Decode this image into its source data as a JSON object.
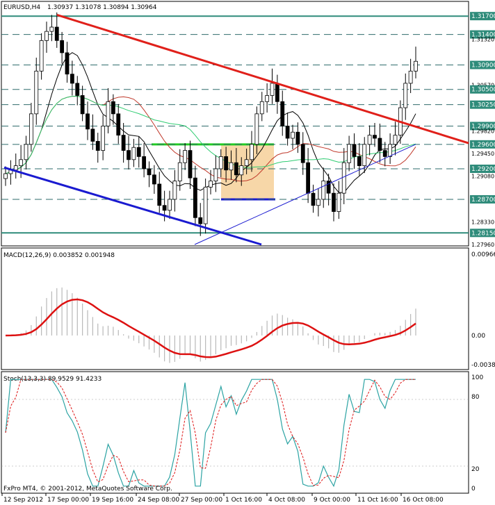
{
  "header": {
    "symbol": "EURUSD,H4",
    "ohlc": "1.30937 1.31078 1.30894 1.30964"
  },
  "colors": {
    "price_level_label_bg": "#2e8b7a",
    "candle": "#000000",
    "trend_down": "#e0201a",
    "channel_low": "#1a1ad0",
    "support_box": "#f7d7a8",
    "green_line": "#22cc22",
    "macd_signal": "#dd1111",
    "stoch_main": "#2ba3a3",
    "stoch_signal": "#dd1111"
  },
  "price_axis": {
    "ticks": [
      "1.31700",
      "1.31400",
      "1.31320",
      "1.30900",
      "1.30570",
      "1.30500",
      "1.30250",
      "1.29900",
      "1.29820",
      "1.29600",
      "1.29450",
      "1.29200",
      "1.29080",
      "1.28700",
      "1.28330",
      "1.28150",
      "1.27960"
    ],
    "boxed_levels": [
      "1.31700",
      "1.31400",
      "1.30900",
      "1.30500",
      "1.30250",
      "1.29900",
      "1.29600",
      "1.29200",
      "1.28700",
      "1.28150"
    ],
    "current": "1.30964"
  },
  "macd": {
    "label": "MACD(12,26,9) 0.003852 0.001948",
    "axis": [
      "0.00966",
      "0.00",
      "-0.00387"
    ]
  },
  "stoch": {
    "label": "Stoch(13,3,3) 89.9529 91.4233",
    "axis": [
      "100",
      "80",
      "20",
      "0"
    ]
  },
  "footer": {
    "copyright": "FxPro MT4, © 2001-2012, MetaQuotes Software Corp."
  },
  "time_axis": [
    "12 Sep 2012",
    "17 Sep 00:00",
    "19 Sep 16:00",
    "24 Sep 08:00",
    "27 Sep 00:00",
    "1 Oct 16:00",
    "4 Oct 08:00",
    "9 Oct 00:00",
    "11 Oct 16:00",
    "16 Oct 08:00"
  ],
  "chart_data": {
    "type": "candlestick",
    "symbol": "EURUSD",
    "timeframe": "H4",
    "price_range": [
      1.2796,
      1.3185
    ],
    "horizontal_levels": [
      1.317,
      1.314,
      1.309,
      1.305,
      1.3025,
      1.299,
      1.296,
      1.292,
      1.287,
      1.2815
    ],
    "close_series": [
      1.2912,
      1.2918,
      1.2925,
      1.2935,
      1.296,
      1.301,
      1.308,
      1.313,
      1.3145,
      1.3152,
      1.313,
      1.311,
      1.3075,
      1.306,
      1.304,
      1.301,
      1.2985,
      1.2965,
      1.295,
      1.299,
      1.303,
      1.301,
      1.2975,
      1.295,
      1.2935,
      1.2955,
      1.294,
      1.292,
      1.291,
      1.2895,
      1.286,
      1.2852,
      1.287,
      1.29,
      1.293,
      1.295,
      1.2905,
      1.284,
      1.283,
      1.289,
      1.29,
      1.292,
      1.294,
      1.2918,
      1.293,
      1.291,
      1.2925,
      1.2935,
      1.296,
      1.301,
      1.303,
      1.304,
      1.306,
      1.303,
      1.299,
      1.297,
      1.298,
      1.296,
      1.293,
      1.288,
      1.286,
      1.287,
      1.29,
      1.288,
      1.285,
      1.288,
      1.293,
      1.296,
      1.294,
      1.2925,
      1.296,
      1.2975,
      1.297,
      1.295,
      1.294,
      1.296,
      1.2975,
      1.302,
      1.306,
      1.308,
      1.3096
    ]
  }
}
